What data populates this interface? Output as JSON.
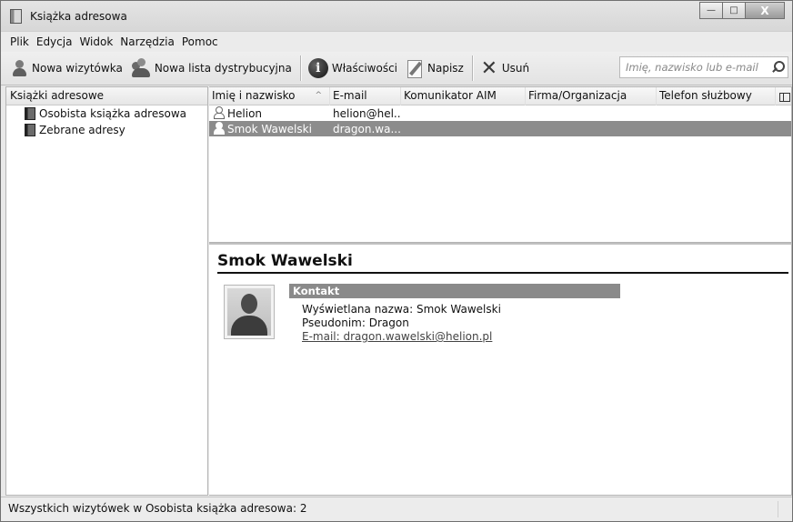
{
  "window": {
    "title": "Książka adresowa",
    "controls": {
      "minimize": "—",
      "maximize": "□",
      "close": "X"
    }
  },
  "menubar": [
    {
      "label": "Plik"
    },
    {
      "label": "Edycja"
    },
    {
      "label": "Widok"
    },
    {
      "label": "Narzędzia"
    },
    {
      "label": "Pomoc"
    }
  ],
  "toolbar": {
    "new_card": {
      "label": "Nowa wizytówka",
      "icon": "new-contact-icon"
    },
    "new_list": {
      "label": "Nowa lista dystrybucyjna",
      "icon": "new-list-icon"
    },
    "properties": {
      "label": "Właściwości",
      "icon": "info-icon",
      "glyph": "i"
    },
    "write": {
      "label": "Napisz",
      "icon": "compose-icon"
    },
    "delete": {
      "label": "Usuń",
      "icon": "delete-icon",
      "glyph": "✕"
    },
    "search_placeholder": "Imię, nazwisko lub e-mail"
  },
  "address_books": {
    "header": "Książki adresowe",
    "items": [
      {
        "label": "Osobista książka adresowa"
      },
      {
        "label": "Zebrane adresy"
      }
    ]
  },
  "contacts": {
    "columns": [
      {
        "label": "Imię i nazwisko",
        "sorted": true,
        "sort_glyph": "^"
      },
      {
        "label": "E-mail"
      },
      {
        "label": "Komunikator AIM"
      },
      {
        "label": "Firma/Organizacja"
      },
      {
        "label": "Telefon służbowy"
      }
    ],
    "rows": [
      {
        "name": "Helion",
        "email": "helion@hel...",
        "selected": false
      },
      {
        "name": "Smok Wawelski",
        "email": "dragon.wa...",
        "selected": true
      }
    ]
  },
  "card": {
    "name": "Smok Wawelski",
    "section": "Kontakt",
    "display_name": "Wyświetlana nazwa: Smok Wawelski",
    "nickname": "Pseudonim: Dragon",
    "email": "E-mail: dragon.wawelski@helion.pl"
  },
  "status": "Wszystkich wizytówek w Osobista książka adresowa: 2",
  "colors": {
    "selection": "#8c8c8c",
    "section_header": "#8a8a8a"
  }
}
